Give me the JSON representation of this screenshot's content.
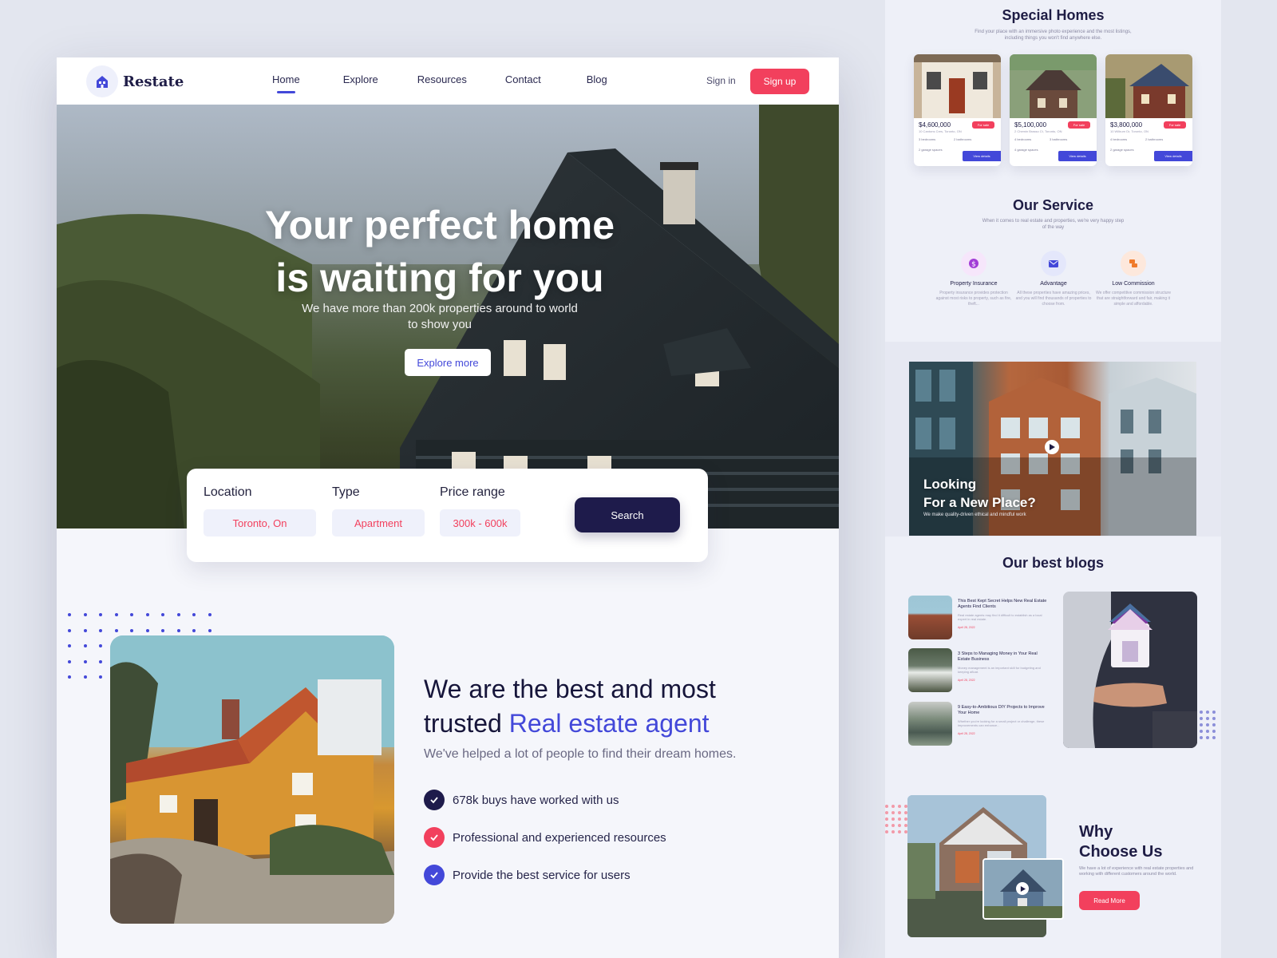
{
  "brand": {
    "name": "Restate"
  },
  "nav": {
    "items": [
      {
        "label": "Home",
        "active": true
      },
      {
        "label": "Explore",
        "active": false
      },
      {
        "label": "Resources",
        "active": false
      },
      {
        "label": "Contact",
        "active": false
      },
      {
        "label": "Blog",
        "active": false
      }
    ],
    "signin_label": "Sign in",
    "signup_label": "Sign up"
  },
  "hero": {
    "title_line1": "Your perfect home",
    "title_line2": "is waiting for you",
    "subtitle": "We have more than 200k properties around to world to show you",
    "cta_label": "Explore more"
  },
  "search": {
    "location_label": "Location",
    "location_value": "Toronto, On",
    "type_label": "Type",
    "type_value": "Apartment",
    "price_label": "Price range",
    "price_value": "300k - 600k",
    "button_label": "Search"
  },
  "about": {
    "title_part1": "We are the best and most trusted ",
    "title_accent": "Real estate agent",
    "subtitle": "We've helped a lot of people to find their dream homes.",
    "features": [
      {
        "text": "678k buys have worked with us",
        "color": "#1e1b4b"
      },
      {
        "text": "Professional and experienced resources",
        "color": "#f2405d"
      },
      {
        "text": "Provide the best service for users",
        "color": "#4348d9"
      }
    ]
  },
  "side": {
    "special_homes": {
      "title": "Special Homes",
      "subtitle": "Find your place with an immersive photo experience and the most listings, including things you won't find anywhere else.",
      "cards": [
        {
          "price": "$4,600,000",
          "tag": "For sale",
          "address": "10 Cantons Cres, Toronto, ON",
          "beds": "3 bedrooms",
          "baths": "2 bathrooms",
          "garage": "2 garage spaces",
          "action": "View details"
        },
        {
          "price": "$5,100,000",
          "tag": "For sale",
          "address": "2 Chemin Brasso Ct, Toronto, ON",
          "beds": "4 bedrooms",
          "baths": "3 bathrooms",
          "garage": "4 garage spaces",
          "action": "View details"
        },
        {
          "price": "$3,800,000",
          "tag": "For sale",
          "address": "10 Wilburn Dr, Toronto, ON",
          "beds": "4 bedrooms",
          "baths": "2 bathrooms",
          "garage": "2 garage spaces",
          "action": "View details"
        }
      ]
    },
    "service": {
      "title": "Our Service",
      "subtitle": "When it comes to real estate and properties, we're very happy step of the way",
      "items": [
        {
          "name": "Property Insurance",
          "desc": "Property insurance provides protection against most risks to property, such as fire, theft...",
          "icon": "dollar-icon",
          "color": "#a23dd6",
          "bg": "#f6e6fb"
        },
        {
          "name": "Advantage",
          "desc": "All these properties have amazing prices, and you will find thousands of properties to choose from.",
          "icon": "mail-icon",
          "color": "#4348d9",
          "bg": "#e4e7fb"
        },
        {
          "name": "Low Commission",
          "desc": "We offer competitive commission structure that are straightforward and fair, making it simple and affordable.",
          "icon": "coins-icon",
          "color": "#f07a2a",
          "bg": "#fde8dc"
        }
      ]
    },
    "banner": {
      "title_line1": "Looking",
      "title_line2": "For a New Place?",
      "subtitle": "We make quality-driven ethical and mindful work"
    },
    "blogs": {
      "title": "Our best blogs",
      "items": [
        {
          "title": "This Best Kept Secret Helps New Real Estate Agents Find Clients",
          "excerpt": "Real estate agents may find it difficult to establish as a local expert in real estate.",
          "date": "April 28, 2022"
        },
        {
          "title": "3 Steps to Managing Money in Your Real Estate Business",
          "excerpt": "Money management is an important skill for budgeting and keeping afloat.",
          "date": "April 28, 2022"
        },
        {
          "title": "9 Easy-to-Ambitious DIY Projects to Improve Your Home",
          "excerpt": "Whether you're looking for a small project or challenge, these improvements can enhance...",
          "date": "April 28, 2022"
        }
      ]
    },
    "why": {
      "title_line1": "Why",
      "title_line2": "Choose Us",
      "text": "We have a lot of experience with real estate properties and working with different customers around the world.",
      "button_label": "Read More"
    }
  }
}
